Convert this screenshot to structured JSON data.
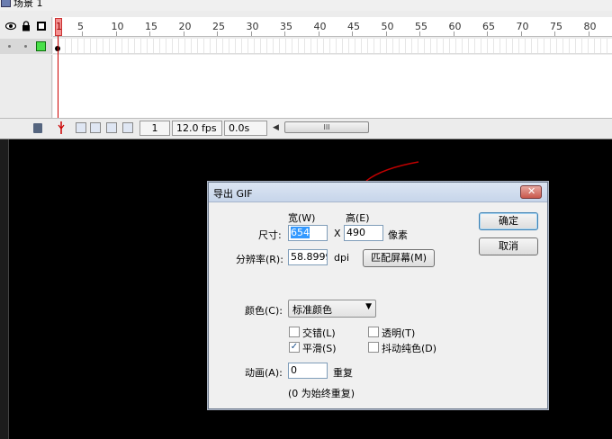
{
  "scene": {
    "label": "场景 1"
  },
  "ruler": {
    "ticks": [
      "1",
      "5",
      "10",
      "15",
      "20",
      "25",
      "30",
      "35",
      "40",
      "45",
      "50",
      "55",
      "60",
      "65",
      "70",
      "75",
      "80"
    ]
  },
  "status": {
    "frame": "1",
    "fps": "12.0 fps",
    "time": "0.0s",
    "scroll_thumb": "III"
  },
  "dialog": {
    "title": "导出 GIF",
    "width_label": "宽(W)",
    "height_label": "高(E)",
    "size_label": "尺寸:",
    "width_value": "654",
    "x_label": "X",
    "height_value": "490",
    "pixels_label": "像素",
    "resolution_label": "分辨率(R):",
    "resolution_value": "58.8999",
    "dpi_label": "dpi",
    "match_screen": "匹配屏幕(M)",
    "ok": "确定",
    "cancel": "取消",
    "color_label": "颜色(C):",
    "color_value": "标准颜色",
    "interlace": "交错(L)",
    "interlace_checked": false,
    "transparent": "透明(T)",
    "transparent_checked": false,
    "smooth": "平滑(S)",
    "smooth_checked": true,
    "dither": "抖动纯色(D)",
    "dither_checked": false,
    "animation_label": "动画(A):",
    "animation_value": "0",
    "repeat_label": "重复",
    "repeat_note": "(0 为始终重复)"
  },
  "colors": {
    "accent_red": "#cc0000",
    "stage": "#000000",
    "layer_square": "#49e049"
  }
}
